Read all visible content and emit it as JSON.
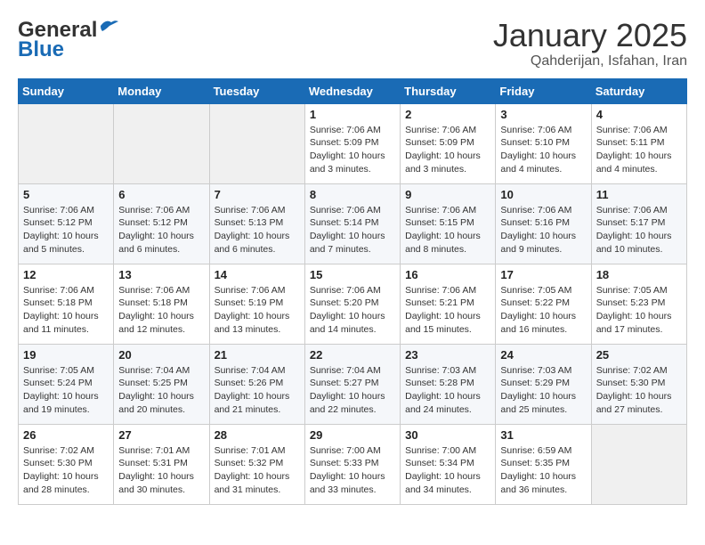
{
  "header": {
    "logo_general": "General",
    "logo_blue": "Blue",
    "month_year": "January 2025",
    "location": "Qahderijan, Isfahan, Iran"
  },
  "weekdays": [
    "Sunday",
    "Monday",
    "Tuesday",
    "Wednesday",
    "Thursday",
    "Friday",
    "Saturday"
  ],
  "weeks": [
    [
      {
        "day": "",
        "info": ""
      },
      {
        "day": "",
        "info": ""
      },
      {
        "day": "",
        "info": ""
      },
      {
        "day": "1",
        "info": "Sunrise: 7:06 AM\nSunset: 5:09 PM\nDaylight: 10 hours\nand 3 minutes."
      },
      {
        "day": "2",
        "info": "Sunrise: 7:06 AM\nSunset: 5:09 PM\nDaylight: 10 hours\nand 3 minutes."
      },
      {
        "day": "3",
        "info": "Sunrise: 7:06 AM\nSunset: 5:10 PM\nDaylight: 10 hours\nand 4 minutes."
      },
      {
        "day": "4",
        "info": "Sunrise: 7:06 AM\nSunset: 5:11 PM\nDaylight: 10 hours\nand 4 minutes."
      }
    ],
    [
      {
        "day": "5",
        "info": "Sunrise: 7:06 AM\nSunset: 5:12 PM\nDaylight: 10 hours\nand 5 minutes."
      },
      {
        "day": "6",
        "info": "Sunrise: 7:06 AM\nSunset: 5:12 PM\nDaylight: 10 hours\nand 6 minutes."
      },
      {
        "day": "7",
        "info": "Sunrise: 7:06 AM\nSunset: 5:13 PM\nDaylight: 10 hours\nand 6 minutes."
      },
      {
        "day": "8",
        "info": "Sunrise: 7:06 AM\nSunset: 5:14 PM\nDaylight: 10 hours\nand 7 minutes."
      },
      {
        "day": "9",
        "info": "Sunrise: 7:06 AM\nSunset: 5:15 PM\nDaylight: 10 hours\nand 8 minutes."
      },
      {
        "day": "10",
        "info": "Sunrise: 7:06 AM\nSunset: 5:16 PM\nDaylight: 10 hours\nand 9 minutes."
      },
      {
        "day": "11",
        "info": "Sunrise: 7:06 AM\nSunset: 5:17 PM\nDaylight: 10 hours\nand 10 minutes."
      }
    ],
    [
      {
        "day": "12",
        "info": "Sunrise: 7:06 AM\nSunset: 5:18 PM\nDaylight: 10 hours\nand 11 minutes."
      },
      {
        "day": "13",
        "info": "Sunrise: 7:06 AM\nSunset: 5:18 PM\nDaylight: 10 hours\nand 12 minutes."
      },
      {
        "day": "14",
        "info": "Sunrise: 7:06 AM\nSunset: 5:19 PM\nDaylight: 10 hours\nand 13 minutes."
      },
      {
        "day": "15",
        "info": "Sunrise: 7:06 AM\nSunset: 5:20 PM\nDaylight: 10 hours\nand 14 minutes."
      },
      {
        "day": "16",
        "info": "Sunrise: 7:06 AM\nSunset: 5:21 PM\nDaylight: 10 hours\nand 15 minutes."
      },
      {
        "day": "17",
        "info": "Sunrise: 7:05 AM\nSunset: 5:22 PM\nDaylight: 10 hours\nand 16 minutes."
      },
      {
        "day": "18",
        "info": "Sunrise: 7:05 AM\nSunset: 5:23 PM\nDaylight: 10 hours\nand 17 minutes."
      }
    ],
    [
      {
        "day": "19",
        "info": "Sunrise: 7:05 AM\nSunset: 5:24 PM\nDaylight: 10 hours\nand 19 minutes."
      },
      {
        "day": "20",
        "info": "Sunrise: 7:04 AM\nSunset: 5:25 PM\nDaylight: 10 hours\nand 20 minutes."
      },
      {
        "day": "21",
        "info": "Sunrise: 7:04 AM\nSunset: 5:26 PM\nDaylight: 10 hours\nand 21 minutes."
      },
      {
        "day": "22",
        "info": "Sunrise: 7:04 AM\nSunset: 5:27 PM\nDaylight: 10 hours\nand 22 minutes."
      },
      {
        "day": "23",
        "info": "Sunrise: 7:03 AM\nSunset: 5:28 PM\nDaylight: 10 hours\nand 24 minutes."
      },
      {
        "day": "24",
        "info": "Sunrise: 7:03 AM\nSunset: 5:29 PM\nDaylight: 10 hours\nand 25 minutes."
      },
      {
        "day": "25",
        "info": "Sunrise: 7:02 AM\nSunset: 5:30 PM\nDaylight: 10 hours\nand 27 minutes."
      }
    ],
    [
      {
        "day": "26",
        "info": "Sunrise: 7:02 AM\nSunset: 5:30 PM\nDaylight: 10 hours\nand 28 minutes."
      },
      {
        "day": "27",
        "info": "Sunrise: 7:01 AM\nSunset: 5:31 PM\nDaylight: 10 hours\nand 30 minutes."
      },
      {
        "day": "28",
        "info": "Sunrise: 7:01 AM\nSunset: 5:32 PM\nDaylight: 10 hours\nand 31 minutes."
      },
      {
        "day": "29",
        "info": "Sunrise: 7:00 AM\nSunset: 5:33 PM\nDaylight: 10 hours\nand 33 minutes."
      },
      {
        "day": "30",
        "info": "Sunrise: 7:00 AM\nSunset: 5:34 PM\nDaylight: 10 hours\nand 34 minutes."
      },
      {
        "day": "31",
        "info": "Sunrise: 6:59 AM\nSunset: 5:35 PM\nDaylight: 10 hours\nand 36 minutes."
      },
      {
        "day": "",
        "info": ""
      }
    ]
  ]
}
